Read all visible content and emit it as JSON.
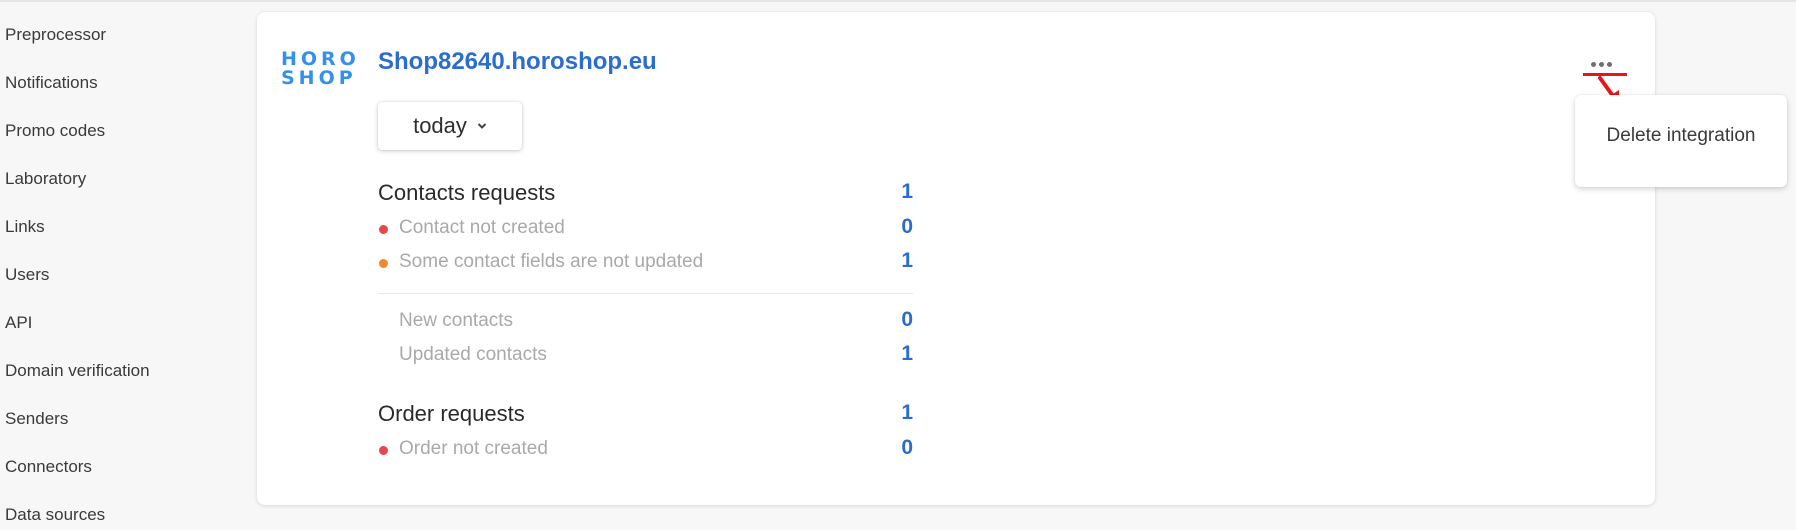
{
  "sidebar": {
    "items": [
      {
        "label": "Preprocessor"
      },
      {
        "label": "Notifications"
      },
      {
        "label": "Promo codes"
      },
      {
        "label": "Laboratory"
      },
      {
        "label": "Links"
      },
      {
        "label": "Users"
      },
      {
        "label": "API"
      },
      {
        "label": "Domain verification"
      },
      {
        "label": "Senders"
      },
      {
        "label": "Connectors"
      },
      {
        "label": "Data sources"
      }
    ]
  },
  "integration": {
    "logo": {
      "line1": "HORO",
      "line2": "SHOP",
      "icon": "horoshop-logo"
    },
    "title": "Shop82640.horoshop.eu",
    "period": {
      "selected": "today",
      "icon": "chevron-down-icon"
    },
    "contacts": {
      "header": {
        "label": "Contacts requests",
        "value": "1"
      },
      "contact_not_created": {
        "label": "Contact not created",
        "value": "0",
        "status_color": "#e5484d"
      },
      "fields_not_updated": {
        "label": "Some contact fields are not updated",
        "value": "1",
        "status_color": "#ef8a2b"
      },
      "new_contacts": {
        "label": "New contacts",
        "value": "0"
      },
      "updated_contacts": {
        "label": "Updated contacts",
        "value": "1"
      }
    },
    "orders": {
      "header": {
        "label": "Order requests",
        "value": "1"
      },
      "order_not_created": {
        "label": "Order not created",
        "value": "0",
        "status_color": "#e5484d"
      }
    },
    "more_menu": {
      "icon": "more-horizontal-icon",
      "items": [
        {
          "label": "Delete integration"
        }
      ]
    }
  },
  "colors": {
    "accent": "#2a6dce",
    "logo": "#3590ec",
    "annotation": "#e8141a"
  }
}
